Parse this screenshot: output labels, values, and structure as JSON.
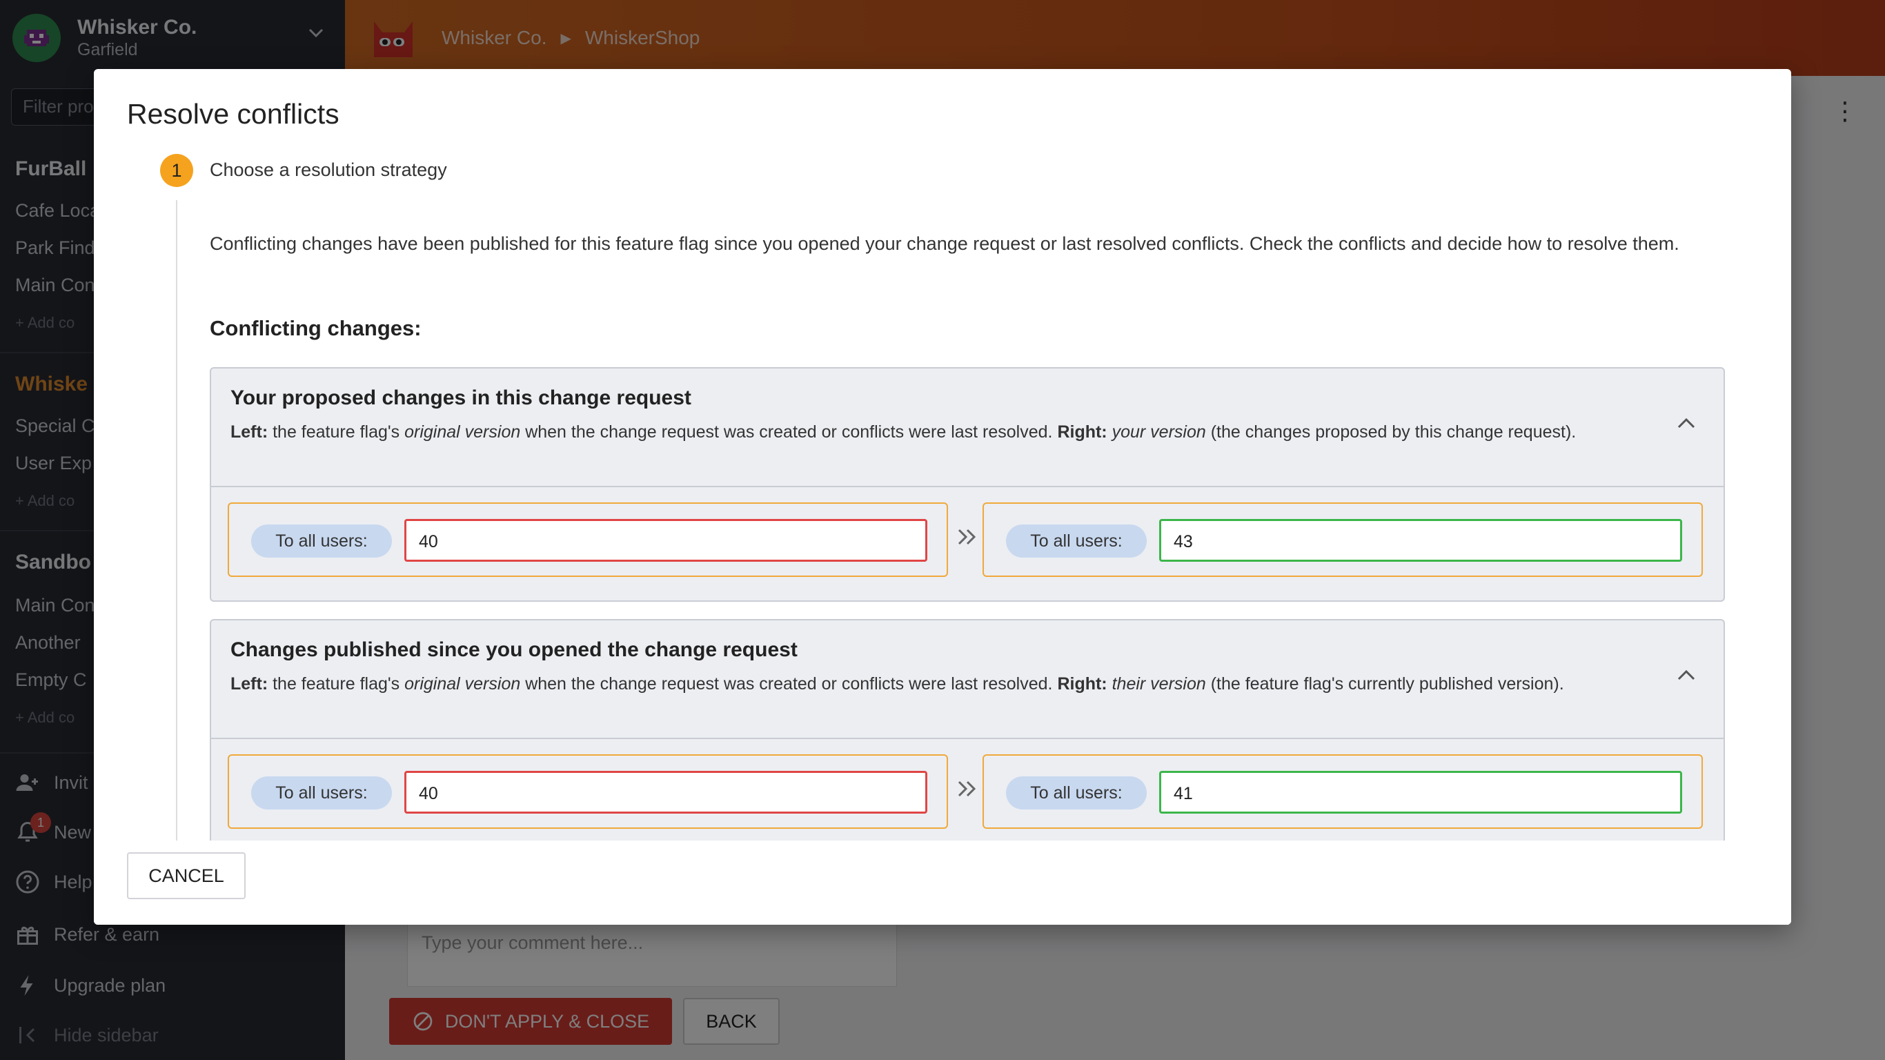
{
  "sidebar": {
    "org_name": "Whisker Co.",
    "org_user": "Garfield",
    "filter_placeholder": "Filter pro",
    "sections": [
      {
        "label": "FurBall",
        "items": [
          "Cafe Loca",
          "Park Find",
          "Main Con"
        ],
        "add_label": "+ Add co"
      },
      {
        "label": "Whiske",
        "items": [
          "Special C",
          "User Exp"
        ],
        "add_label": "+ Add co"
      },
      {
        "label": "Sandbo",
        "items": [
          "Main Con",
          "Another",
          "Empty C"
        ],
        "add_label": "+ Add co"
      }
    ],
    "footer": {
      "invite": "Invit",
      "news": "New",
      "news_badge": "1",
      "help": "Help",
      "refer": "Refer & earn",
      "upgrade": "Upgrade plan",
      "hide": "Hide sidebar"
    }
  },
  "topbar": {
    "breadcrumb": [
      "Whisker Co.",
      "WhiskerShop"
    ]
  },
  "background": {
    "comment_placeholder": "Type your comment here...",
    "dont_apply_label": "DON'T APPLY & CLOSE",
    "back_label": "BACK"
  },
  "dialog": {
    "title": "Resolve conflicts",
    "step_number": "1",
    "step_label": "Choose a resolution strategy",
    "intro": "Conflicting changes have been published for this feature flag since you opened your change request or last resolved conflicts. Check the conflicts and decide how to resolve them.",
    "conflicting_heading": "Conflicting changes:",
    "panels": [
      {
        "title": "Your proposed changes in this change request",
        "left_bold": "Left:",
        "left_text_a": " the feature flag's ",
        "left_italic": "original version",
        "left_text_b": " when the change request was created or conflicts were last resolved. ",
        "right_bold": "Right:",
        "right_text_a": " ",
        "right_italic": "your version",
        "right_text_b": " (the changes proposed by this change request).",
        "left_label": "To all users:",
        "left_value": "40",
        "right_label": "To all users:",
        "right_value": "43"
      },
      {
        "title": "Changes published since you opened the change request",
        "left_bold": "Left:",
        "left_text_a": " the feature flag's ",
        "left_italic": "original version",
        "left_text_b": " when the change request was created or conflicts were last resolved. ",
        "right_bold": "Right:",
        "right_text_a": " ",
        "right_italic": "their version",
        "right_text_b": " (the feature flag's currently published version).",
        "left_label": "To all users:",
        "left_value": "40",
        "right_label": "To all users:",
        "right_value": "41"
      }
    ],
    "cancel_label": "CANCEL"
  },
  "colors": {
    "accent_orange": "#f5a21f",
    "conflict_border": "#f0a93a",
    "original_red": "#e04545",
    "new_green": "#3cb64a",
    "danger_button": "#d23a32"
  }
}
